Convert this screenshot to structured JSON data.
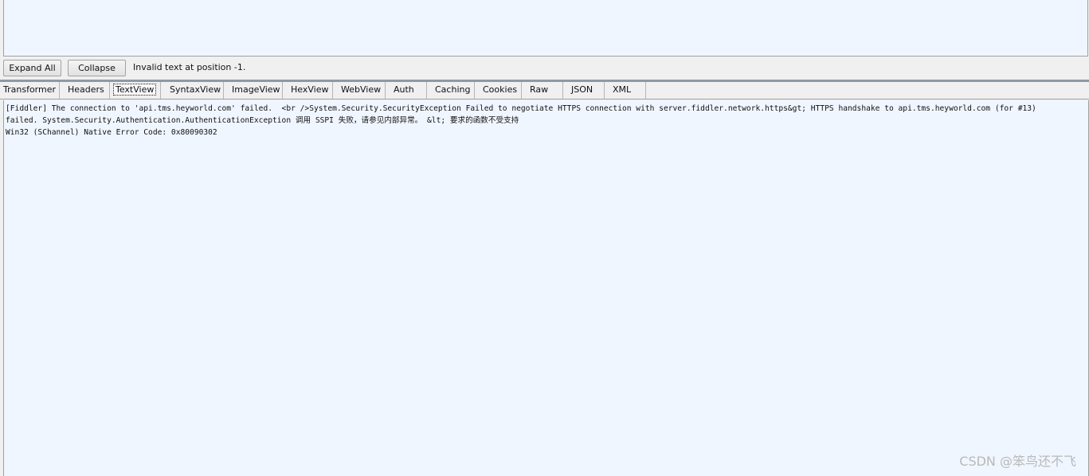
{
  "toolbar": {
    "expand_all_label": "Expand All",
    "collapse_label": "Collapse",
    "status": "Invalid text at position -1."
  },
  "tabs": [
    {
      "label": "Transformer"
    },
    {
      "label": "Headers"
    },
    {
      "label": "TextView",
      "active": true
    },
    {
      "label": "SyntaxView"
    },
    {
      "label": "ImageView"
    },
    {
      "label": "HexView"
    },
    {
      "label": "WebView"
    },
    {
      "label": "Auth"
    },
    {
      "label": "Caching"
    },
    {
      "label": "Cookies"
    },
    {
      "label": "Raw"
    },
    {
      "label": "JSON"
    },
    {
      "label": "XML"
    }
  ],
  "content": {
    "lines": [
      "[Fiddler] The connection to 'api.tms.heyworld.com' failed.  <br />System.Security.SecurityException Failed to negotiate HTTPS connection with server.fiddler.network.https&gt; HTTPS handshake to api.tms.heyworld.com (for #13)",
      "failed. System.Security.Authentication.AuthenticationException 调用 SSPI 失败，请参见内部异常。 &lt; 要求的函数不受支持",
      "",
      "Win32 (SChannel) Native Error Code: 0x80090302"
    ]
  },
  "watermark": "CSDN @笨鸟还不飞"
}
